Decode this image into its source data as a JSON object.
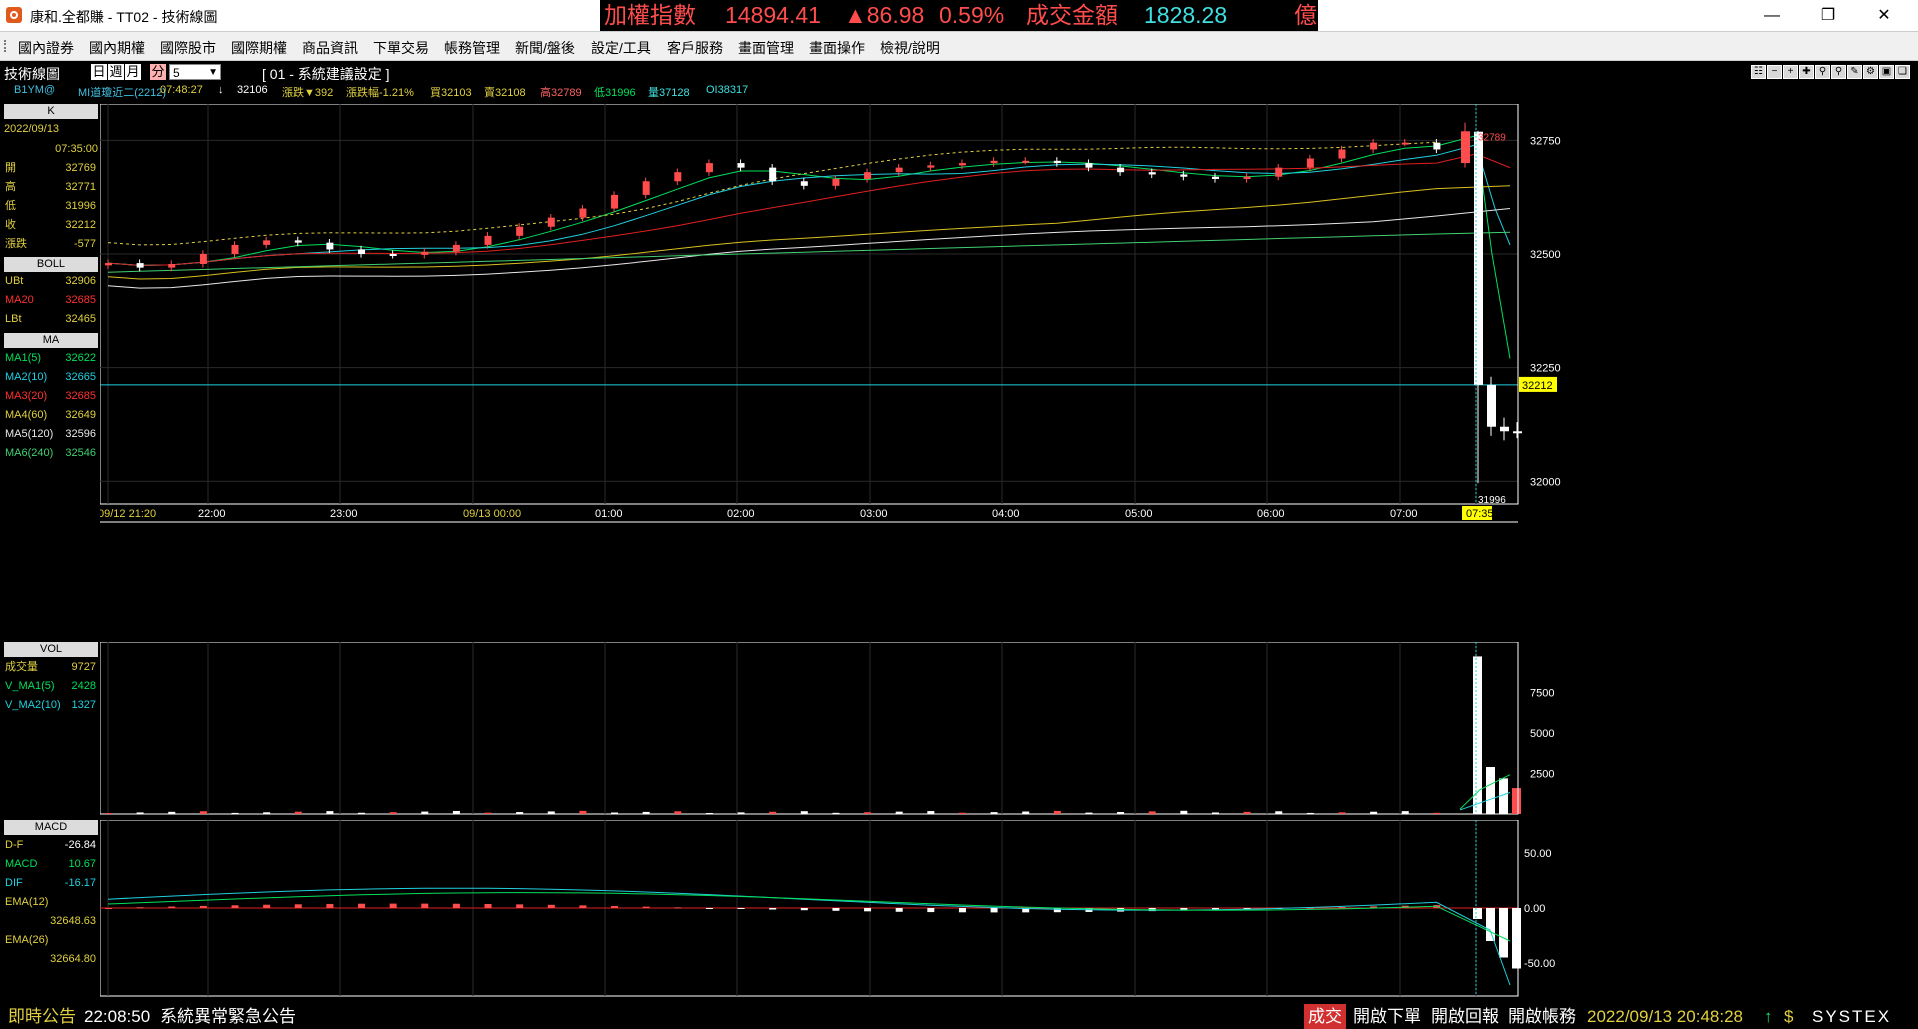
{
  "window": {
    "title": "康和.全都賺 - TT02 - 技術線圖",
    "minimize_icon": "minimize-icon",
    "maximize_icon": "restore-icon",
    "close_icon": "close-icon"
  },
  "ticker": {
    "name": "加權指數",
    "value": "14894.41",
    "change": "▲86.98",
    "pct": "0.59%",
    "amount_label": "成交金額",
    "amount": "1828.28",
    "unit": "億"
  },
  "menu": [
    "國內證券",
    "國內期權",
    "國際股市",
    "國際期權",
    "商品資訊",
    "下單交易",
    "帳務管理",
    "新聞/盤後",
    "設定/工具",
    "客戶服務",
    "畫面管理",
    "畫面操作",
    "檢視/說明"
  ],
  "toolbar": {
    "module_title": "技術線圖",
    "periods": [
      "日",
      "週",
      "月",
      "分"
    ],
    "interval": "5",
    "config_label": "[ 01 - 系統建議設定 ]",
    "tool_icons": [
      "layout-icon",
      "minus-icon",
      "plus-icon",
      "cross-icon",
      "zoom-in-icon",
      "zoom-out-icon",
      "draw-icon",
      "settings-icon",
      "save-icon",
      "copy-icon",
      "export-icon"
    ]
  },
  "quote": {
    "symbol": "B1YM@",
    "name": "MI道瓊近二(2212)",
    "time": "07:48:27",
    "arrow": "↓",
    "price": "32106",
    "change": "漲跌▼392",
    "change_pct": "漲跌幅-1.21%",
    "bid": "買32103",
    "ask": "賣32108",
    "high": "高32789",
    "low": "低31996",
    "volume": "量37128",
    "oi": "OI38317"
  },
  "k_panel": {
    "header": "K",
    "date": "2022/09/13",
    "time": "07:35:00",
    "rows": [
      {
        "label": "開",
        "value": "32769"
      },
      {
        "label": "高",
        "value": "32771"
      },
      {
        "label": "低",
        "value": "31996"
      },
      {
        "label": "收",
        "value": "32212"
      },
      {
        "label": "漲跌",
        "value": "-577"
      }
    ]
  },
  "boll_panel": {
    "header": "BOLL",
    "rows": [
      {
        "label": "UBt",
        "value": "32906"
      },
      {
        "label": "MA20",
        "value": "32685"
      },
      {
        "label": "LBt",
        "value": "32465"
      }
    ]
  },
  "ma_panel": {
    "header": "MA",
    "rows": [
      {
        "label": "MA1(5)",
        "value": "32622"
      },
      {
        "label": "MA2(10)",
        "value": "32665"
      },
      {
        "label": "MA3(20)",
        "value": "32685"
      },
      {
        "label": "MA4(60)",
        "value": "32649"
      },
      {
        "label": "MA5(120)",
        "value": "32596"
      },
      {
        "label": "MA6(240)",
        "value": "32546"
      }
    ]
  },
  "vol_panel": {
    "header": "VOL",
    "rows": [
      {
        "label": "成交量",
        "value": "9727"
      },
      {
        "label": "V_MA1(5)",
        "value": "2428"
      },
      {
        "label": "V_MA2(10)",
        "value": "1327"
      }
    ]
  },
  "macd_panel": {
    "header": "MACD",
    "rows": [
      {
        "label": "D-F",
        "value": "-26.84"
      },
      {
        "label": "MACD",
        "value": "10.67"
      },
      {
        "label": "DIF",
        "value": "-16.17"
      },
      {
        "label": "EMA(12)",
        "value": ""
      },
      {
        "label": "",
        "value": "32648.63"
      },
      {
        "label": "EMA(26)",
        "value": ""
      },
      {
        "label": "",
        "value": "32664.80"
      }
    ]
  },
  "price_axis": {
    "ticks": [
      "32750",
      "32500",
      "32250",
      "32000"
    ],
    "current": "32212",
    "high_label": "32789",
    "low_label": "31996"
  },
  "time_axis": [
    "09/12 21:20",
    "22:00",
    "23:00",
    "09/13 00:00",
    "01:00",
    "02:00",
    "03:00",
    "04:00",
    "05:00",
    "06:00",
    "07:00",
    "07:35"
  ],
  "vol_axis": [
    "7500",
    "5000",
    "2500"
  ],
  "macd_axis": [
    "50.00",
    "0.00",
    "-50.00"
  ],
  "colors": {
    "up": "#ff4d4d",
    "down": "#ffffff",
    "ma5": "#00e05a",
    "ma10": "#20d0e0",
    "ma20": "#e02020",
    "ma60": "#d8c020",
    "ma120": "#e8e8e8",
    "ma240": "#40d070",
    "boll": "#e0d040"
  },
  "chart_data": {
    "type": "candlestick",
    "symbol": "B1YM@",
    "interval_minutes": 5,
    "ylim": [
      31950,
      32830
    ],
    "series_anchor_closes": [
      32480,
      32470,
      32478,
      32500,
      32520,
      32530,
      32525,
      32510,
      32500,
      32498,
      32505,
      32520,
      32540,
      32560,
      32580,
      32600,
      32630,
      32660,
      32680,
      32700,
      32690,
      32660,
      32650,
      32665,
      32680,
      32690,
      32695,
      32700,
      32705,
      32705,
      32700,
      32690,
      32680,
      32675,
      32670,
      32665,
      32670,
      32690,
      32710,
      32730,
      32745,
      32745,
      32730
    ],
    "last_bars": [
      {
        "time": "07:25",
        "open": 32700,
        "high": 32789,
        "low": 32690,
        "close": 32770
      },
      {
        "time": "07:30",
        "open": 32769,
        "high": 32771,
        "low": 31996,
        "close": 32212
      },
      {
        "time": "07:35",
        "open": 32212,
        "high": 32230,
        "low": 32100,
        "close": 32120
      },
      {
        "time": "07:40",
        "open": 32120,
        "high": 32140,
        "low": 32090,
        "close": 32110
      },
      {
        "time": "07:45",
        "open": 32110,
        "high": 32130,
        "low": 32095,
        "close": 32106
      }
    ],
    "volume": {
      "last": 9727,
      "v_ma5": 2428,
      "v_ma10": 1327,
      "ylim": [
        0,
        10000
      ]
    },
    "macd": {
      "df": -26.84,
      "macd": 10.67,
      "dif": -16.17,
      "ylim": [
        -80,
        80
      ]
    }
  },
  "status": {
    "label": "即時公告",
    "time": "22:08:50",
    "message": "系統異常緊急公告",
    "tag": "成交",
    "buttons": [
      "開啟下單",
      "開啟回報",
      "開啟帳務"
    ],
    "datetime": "2022/09/13 20:48:28",
    "brand": "SYSTEX"
  }
}
